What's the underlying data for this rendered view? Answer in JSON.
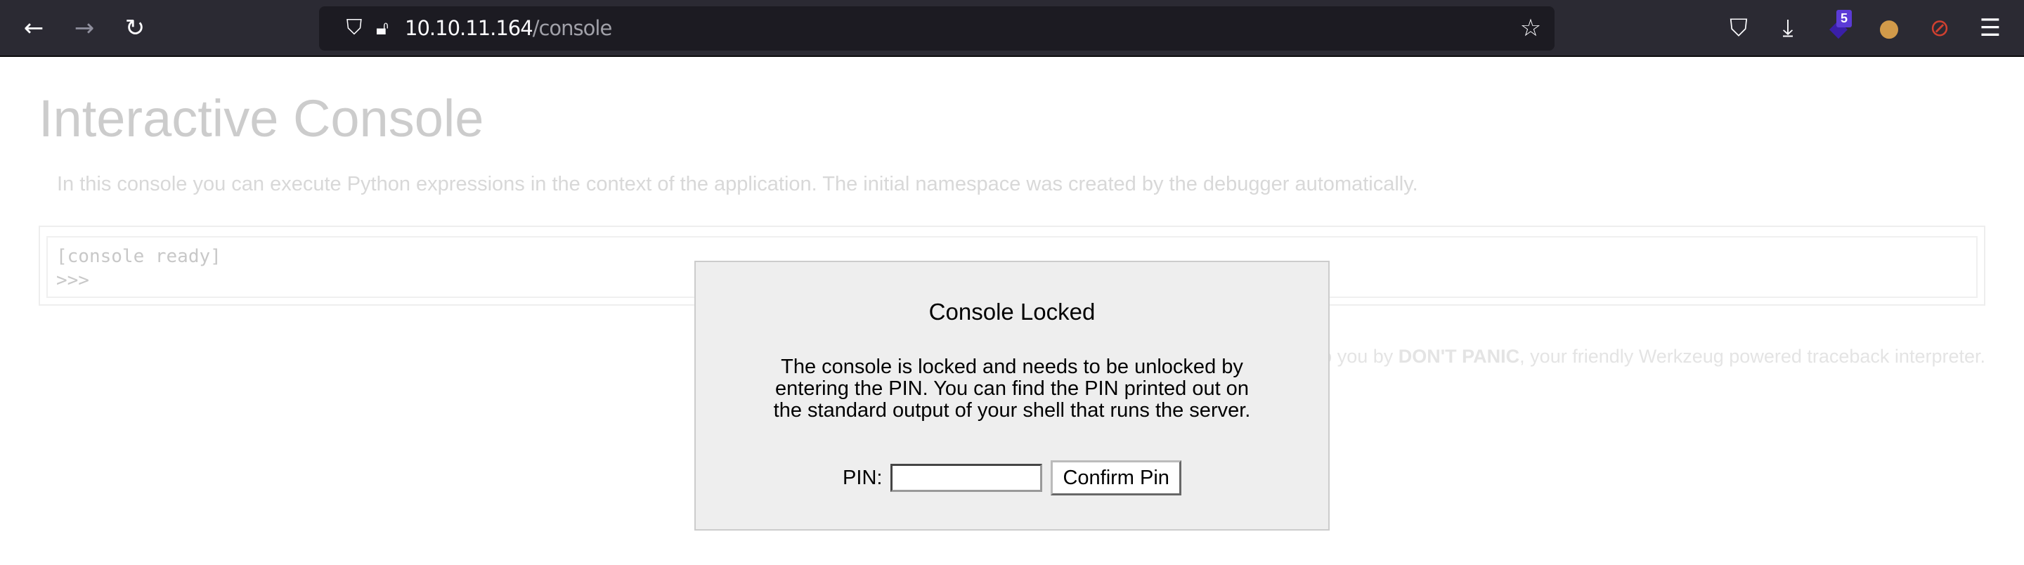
{
  "browser": {
    "url_host": "10.10.11.164",
    "url_path": "/console",
    "extension_badge": "5",
    "icons": [
      "back-icon",
      "forward-icon",
      "reload-icon",
      "shield-icon",
      "insecure-lock-icon",
      "star-icon",
      "pocket-icon",
      "download-icon",
      "extension-icon",
      "cookie-icon",
      "blocker-icon",
      "menu-icon"
    ]
  },
  "page": {
    "title": "Interactive Console",
    "intro": "In this console you can execute Python expressions in the context of the application. The initial namespace was created by the debugger automatically.",
    "console_ready": "[console ready]",
    "prompt": ">>>",
    "footer_prefix": "Brought to you by ",
    "footer_bold": "DON'T PANIC",
    "footer_suffix": ", your friendly Werkzeug powered traceback interpreter."
  },
  "modal": {
    "title": "Console Locked",
    "message": "The console is locked and needs to be unlocked by entering the PIN. You can find the PIN printed out on the standard output of your shell that runs the server.",
    "pin_label": "PIN:",
    "pin_value": "",
    "confirm_label": "Confirm Pin"
  }
}
